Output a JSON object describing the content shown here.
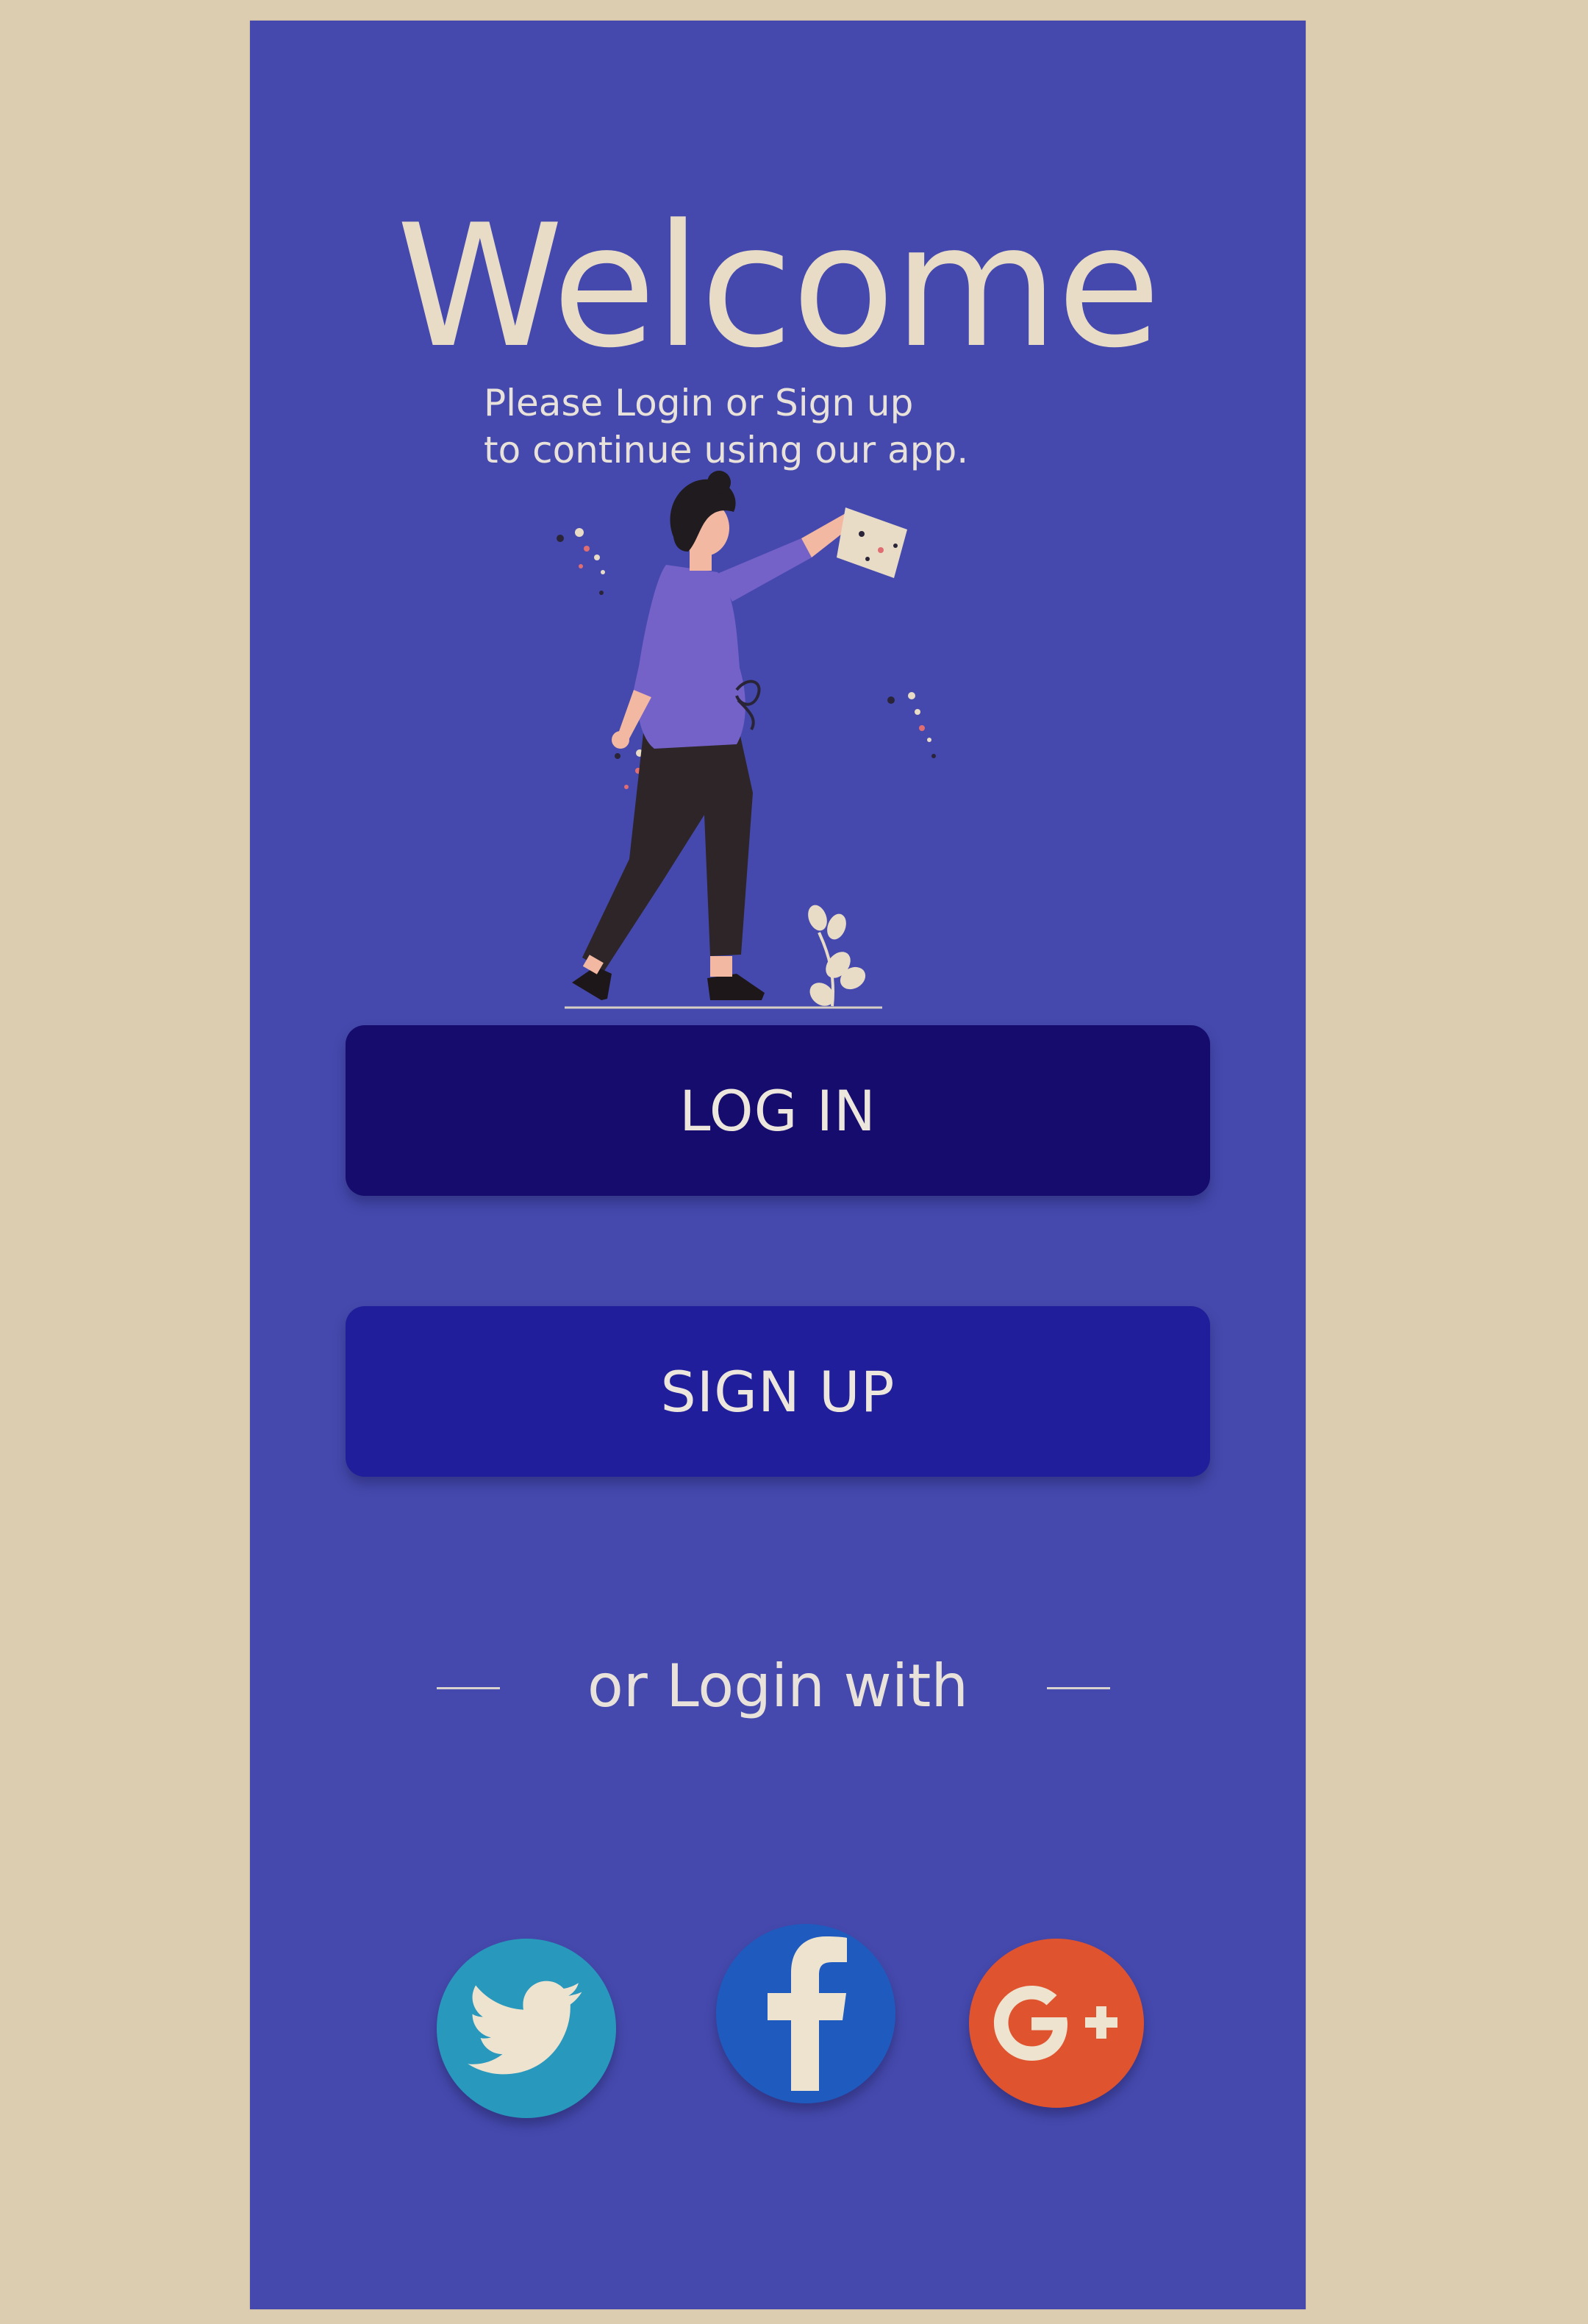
{
  "welcome": {
    "title": "Welcome",
    "subtitle_line1": "Please Login or Sign up",
    "subtitle_line2": "to continue using our app."
  },
  "buttons": {
    "login_label": "LOG IN",
    "signup_label": "SIGN UP"
  },
  "divider": {
    "text": "or Login with"
  },
  "social": [
    {
      "name": "twitter-icon",
      "color": "#2898bd"
    },
    {
      "name": "facebook-icon",
      "color": "#1f5bbf"
    },
    {
      "name": "google-plus-icon",
      "color": "#e0532f"
    }
  ],
  "colors": {
    "background": "#dccdb0",
    "screen": "#4549ad",
    "login_button": "#150c6e",
    "signup_button": "#201e9a",
    "text_light": "#e8dcc6"
  }
}
